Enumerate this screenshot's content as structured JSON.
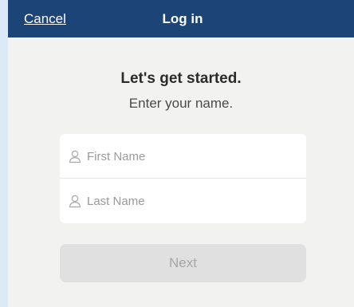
{
  "navbar": {
    "cancel_label": "Cancel",
    "title": "Log in"
  },
  "main": {
    "heading": "Let's get started.",
    "subheading": "Enter your name."
  },
  "form": {
    "first_name": {
      "value": "",
      "placeholder": "First Name",
      "icon": "person-icon"
    },
    "last_name": {
      "value": "",
      "placeholder": "Last Name",
      "icon": "person-icon"
    },
    "next_label": "Next"
  },
  "colors": {
    "navbar_bg": "#1c4477",
    "page_bg": "#f2f2f1",
    "side_strip": "#dbeaf6",
    "button_disabled_bg": "#e0e0e0",
    "button_disabled_text": "#a6a6a6"
  }
}
